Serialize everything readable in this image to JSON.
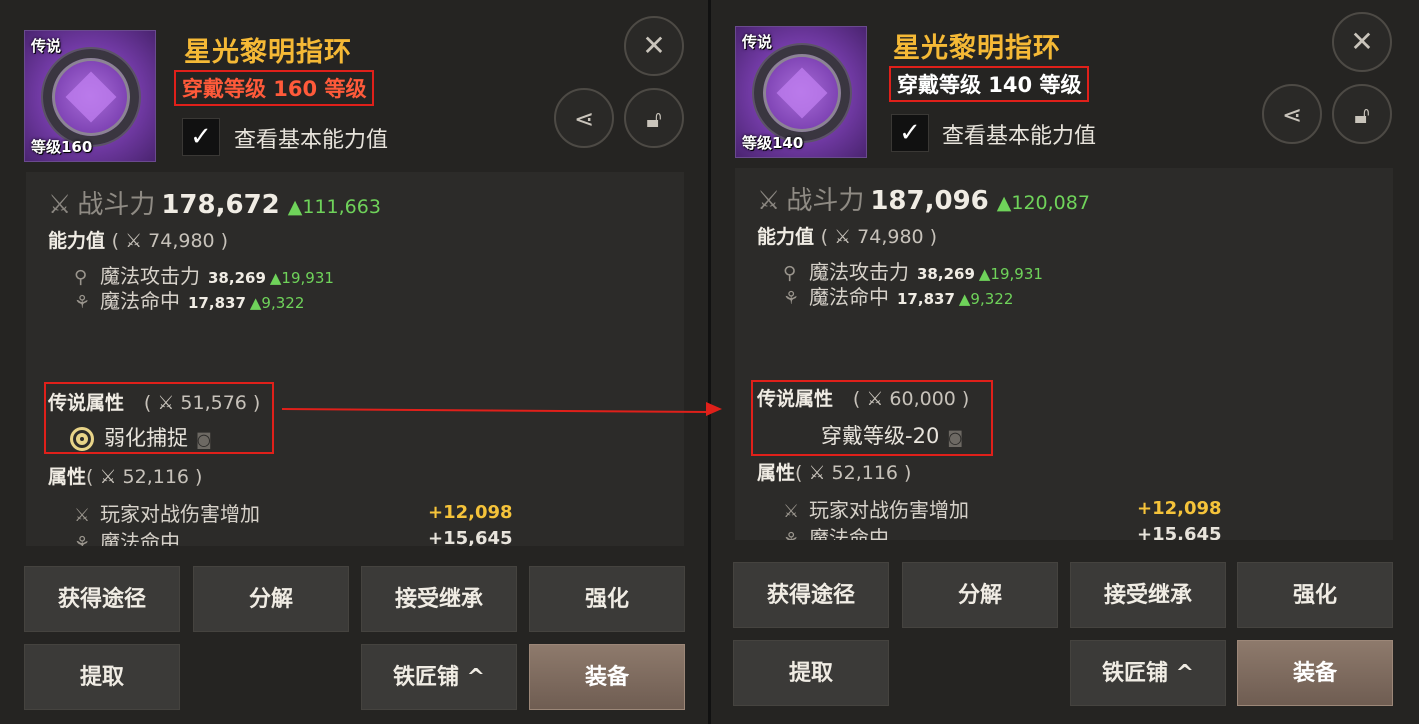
{
  "left": {
    "thumb": {
      "rarity": "传说",
      "level_tag": "等级160"
    },
    "item_name": "星光黎明指环",
    "wear_level": "穿戴等级 160 等级",
    "check_label": "查看基本能力值",
    "combat_power": {
      "label": "战斗力",
      "value": "178,672",
      "delta": "▲111,663"
    },
    "ability": {
      "title": "能力值",
      "sub": "( ⚔ 74,980 )"
    },
    "ability_stats": [
      {
        "name": "魔法攻击力",
        "value": "38,269",
        "delta": "▲19,931"
      },
      {
        "name": "魔法命中",
        "value": "17,837",
        "delta": "▲9,322"
      }
    ],
    "legend": {
      "title": "传说属性",
      "sub": "( ⚔ 51,576 )",
      "option": "弱化捕捉"
    },
    "props": {
      "title": "属性",
      "sub": "( ⚔ 52,116 )"
    },
    "prop_rows": [
      {
        "name": "玩家对战伤害增加",
        "value": "+12,098"
      },
      {
        "name": "魔法命中",
        "value": "+15,645"
      }
    ],
    "buttons": {
      "obtain": "获得途径",
      "decompose": "分解",
      "inherit": "接受继承",
      "enhance": "强化",
      "extract": "提取",
      "smith": "铁匠铺 ^",
      "equip": "装备"
    }
  },
  "right": {
    "thumb": {
      "rarity": "传说",
      "level_tag": "等级140"
    },
    "item_name": "星光黎明指环",
    "wear_level": "穿戴等级 140 等级",
    "check_label": "查看基本能力值",
    "combat_power": {
      "label": "战斗力",
      "value": "187,096",
      "delta": "▲120,087"
    },
    "ability": {
      "title": "能力值",
      "sub": "( ⚔ 74,980 )"
    },
    "ability_stats": [
      {
        "name": "魔法攻击力",
        "value": "38,269",
        "delta": "▲19,931"
      },
      {
        "name": "魔法命中",
        "value": "17,837",
        "delta": "▲9,322"
      }
    ],
    "legend": {
      "title": "传说属性",
      "sub": "( ⚔ 60,000 )",
      "option": "穿戴等级-20"
    },
    "props": {
      "title": "属性",
      "sub": "( ⚔ 52,116 )"
    },
    "prop_rows": [
      {
        "name": "玩家对战伤害增加",
        "value": "+12,098"
      },
      {
        "name": "魔法命中",
        "value": "+15,645"
      }
    ],
    "buttons": {
      "obtain": "获得途径",
      "decompose": "分解",
      "inherit": "接受继承",
      "enhance": "强化",
      "extract": "提取",
      "smith": "铁匠铺 ^",
      "equip": "装备"
    }
  },
  "icons": {
    "close": "close-icon",
    "share": "share-icon",
    "lock": "lock-icon",
    "check": "check-icon",
    "sword": "crossed-swords-icon"
  },
  "colors": {
    "item_name": "#f5b936",
    "highlight": "#e0201a",
    "delta": "#6fd35a",
    "prop_value": "#f5c33a",
    "equip_button": "#7d6a5e"
  }
}
